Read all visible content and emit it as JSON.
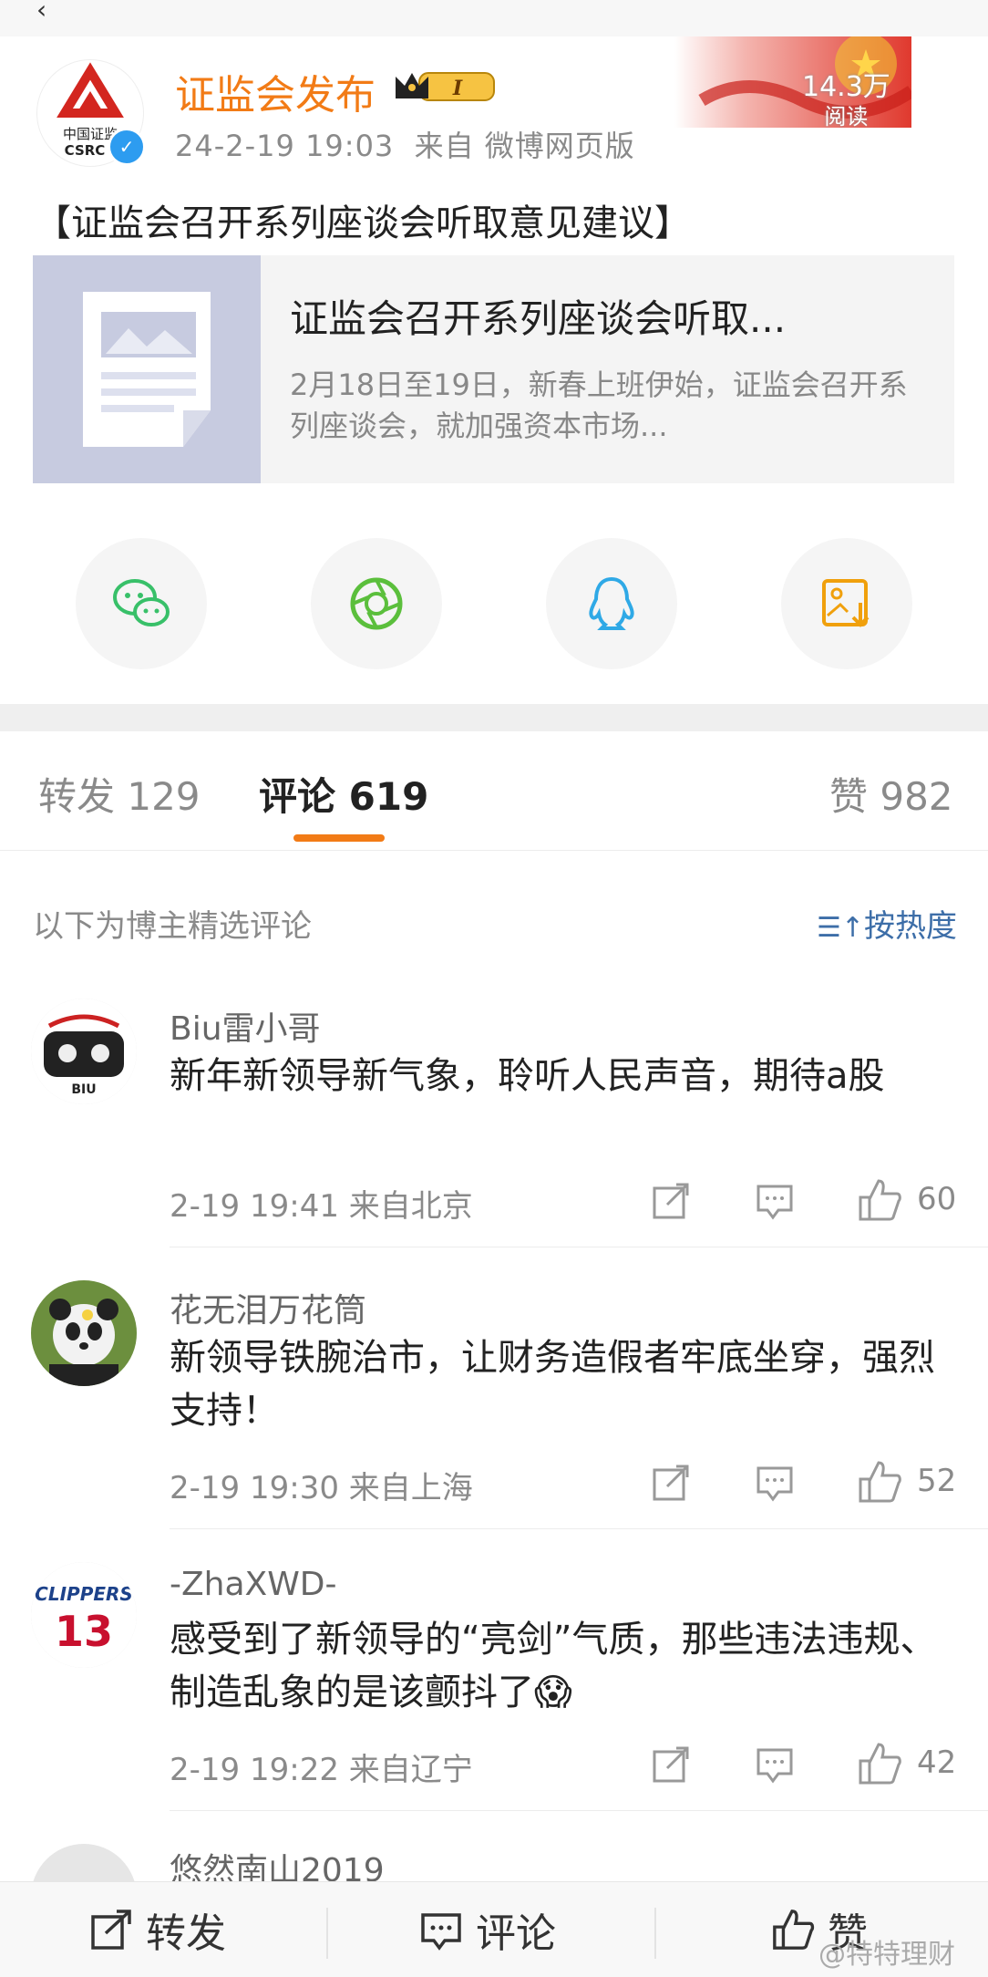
{
  "post": {
    "author": "证监会发布",
    "level_badge": "I",
    "logo_text_top": "中国证监",
    "logo_text_bottom": "CSRC",
    "time": "24-2-19 19:03",
    "source": "来自 微博网页版",
    "reads_count": "14.3万",
    "reads_label": "阅读",
    "headline": "【证监会召开系列座谈会听取意见建议】",
    "card": {
      "title": "证监会召开系列座谈会听取...",
      "description": "2月18日至19日，新春上班伊始，证监会召开系列座谈会，就加强资本市场..."
    },
    "share_icons": [
      "wechat-icon",
      "moments-icon",
      "qq-icon",
      "save-image-icon"
    ]
  },
  "tabs": {
    "repost": "转发 129",
    "comment": "评论 619",
    "like": "赞 982"
  },
  "comments_header": {
    "label": "以下为博主精选评论",
    "sort": "按热度"
  },
  "comments": [
    {
      "name": "Biu雷小哥",
      "text": "新年新领导新气象，聆听人民声音，期待a股",
      "time": "2-19 19:41 来自北京",
      "likes": "60"
    },
    {
      "name": "花无泪万花筒",
      "text": "新领导铁腕治市，让财务造假者牢底坐穿，强烈支持！",
      "time": "2-19 19:30 来自上海",
      "likes": "52"
    },
    {
      "name": "-ZhaXWD-",
      "text": "感受到了新领导的“亮剑”气质，那些违法违规、制造乱象的是该颤抖了😱",
      "time": "2-19 19:22 来自辽宁",
      "likes": "42"
    },
    {
      "name": "悠然南山2019"
    }
  ],
  "avatar_text": {
    "biu": "BIU",
    "clippers": "CLIPPERS",
    "number": "13"
  },
  "bottom_bar": {
    "repost": "转发",
    "comment": "评论",
    "like": "赞"
  },
  "watermark": "@特特理财",
  "colors": {
    "accent": "#f27b16",
    "link": "#3d6ea8",
    "verified": "#2d9cf0"
  }
}
